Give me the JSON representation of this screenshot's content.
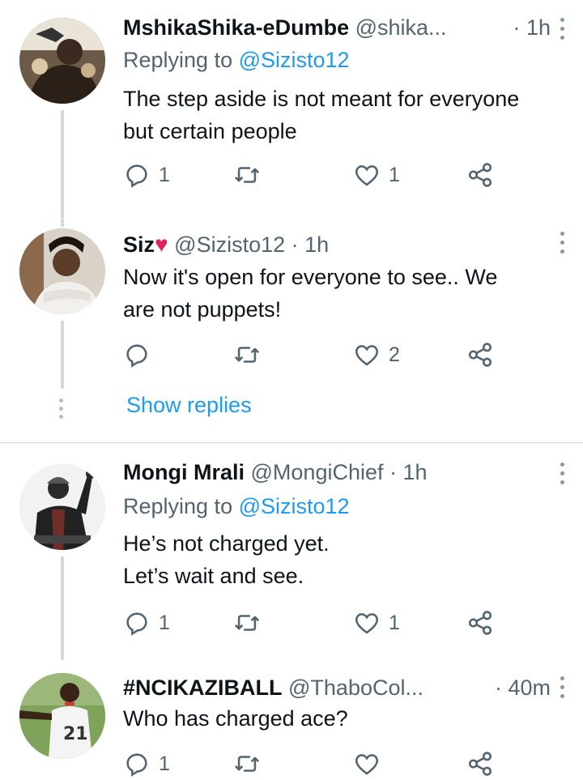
{
  "tweets": [
    {
      "name": "MshikaShika-eDumbe",
      "handle": "@shika...",
      "time": "· 1h",
      "replying_prefix": "Replying to ",
      "replying_to": "@Sizisto12",
      "text": "The step aside is not meant for everyone\nbut certain people",
      "reply_count": "1",
      "retweet_count": "",
      "like_count": "1"
    },
    {
      "name": "Siz",
      "name_emoji": "♥",
      "handle": "@Sizisto12 · 1h",
      "time": "",
      "text": "Now it's open for everyone to see.. We\nare not puppets!",
      "reply_count": "",
      "retweet_count": "",
      "like_count": "2"
    },
    {
      "name": "Mongi Mrali",
      "handle": "@MongiChief · 1h",
      "time": "",
      "replying_prefix": "Replying to ",
      "replying_to": "@Sizisto12",
      "text": "He’s not charged yet.\nLet’s wait and see.",
      "reply_count": "1",
      "retweet_count": "",
      "like_count": "1"
    },
    {
      "name": "#NCIKAZIBALL",
      "handle": "@ThaboCol...",
      "time": "· 40m",
      "text": "Who has charged ace?",
      "reply_count": "1",
      "retweet_count": "",
      "like_count": ""
    }
  ],
  "show_replies": "Show replies",
  "jersey_number": "21",
  "colors": {
    "accent": "#1d9bf0",
    "secondary_text": "#536471",
    "thread_line": "#cfd9de",
    "heart": "#e0245e"
  },
  "icons": [
    "reply-icon",
    "retweet-icon",
    "like-icon",
    "share-icon",
    "more-options-icon"
  ]
}
